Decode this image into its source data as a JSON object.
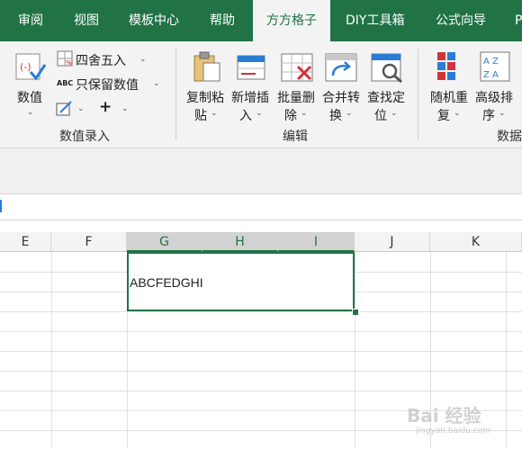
{
  "tabs": [
    "审阅",
    "视图",
    "模板中心",
    "帮助",
    "方方格子",
    "DIY工具箱",
    "公式向导",
    "P"
  ],
  "active_tab": "方方格子",
  "ribbon": {
    "numeric_input": {
      "value_button": "数值",
      "round_label": "四舍五入",
      "keep_numeric_label": "只保留数值",
      "abc_glyph": "ABC",
      "plus_glyph": "+",
      "group_label": "数值录入"
    },
    "edit": {
      "copy_paste_line1": "复制粘",
      "copy_paste_line2": "贴",
      "insert_line1": "新增插",
      "insert_line2": "入",
      "batch_delete_line1": "批量删",
      "batch_delete_line2": "除",
      "merge_line1": "合并转",
      "merge_line2": "换",
      "find_line1": "查找定",
      "find_line2": "位",
      "group_label": "编辑"
    },
    "data": {
      "shuffle_line1": "随机重",
      "shuffle_line2": "复",
      "sort_line1": "高级排",
      "sort_line2": "序",
      "sort_icon_top": "A Z",
      "sort_icon_bottom": "Z A",
      "group_label": "数据"
    }
  },
  "columns": [
    "E",
    "F",
    "G",
    "H",
    "I",
    "J",
    "K"
  ],
  "selected_columns": [
    "G",
    "H",
    "I"
  ],
  "cell_value": "ABCFEDGHI",
  "watermark": {
    "main": "Bai 经验",
    "sub": "jingyan.baidu.com"
  },
  "colors": {
    "accent": "#217346",
    "ribbon_bg": "#f3f3f3"
  }
}
